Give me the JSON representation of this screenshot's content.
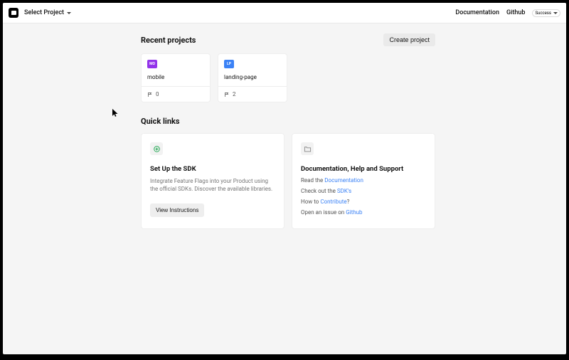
{
  "header": {
    "project_selector": "Select Project",
    "nav": {
      "docs": "Documentation",
      "github": "Github"
    },
    "user_label": "Success"
  },
  "recent_projects": {
    "title": "Recent projects",
    "create_button": "Create project",
    "cards": [
      {
        "badge_text": "MO",
        "badge_class": "badge-purple",
        "name": "mobile",
        "flag_count": "0"
      },
      {
        "badge_text": "LP",
        "badge_class": "badge-blue",
        "name": "landing-page",
        "flag_count": "2"
      }
    ]
  },
  "quick_links": {
    "title": "Quick links",
    "sdk": {
      "title": "Set Up the SDK",
      "description": "Integrate Feature Flags into your Product using the official SDKs. Discover the available libraries.",
      "button": "View Instructions"
    },
    "docs": {
      "title": "Documentation, Help and Support",
      "line1_prefix": "Read the ",
      "line1_link": "Documentation",
      "line2_prefix": "Check out the ",
      "line2_link": "SDK's",
      "line3_prefix": "How to ",
      "line3_link": "Contribute",
      "line3_suffix": "?",
      "line4_prefix": "Open an issue on ",
      "line4_link": "Github"
    }
  }
}
